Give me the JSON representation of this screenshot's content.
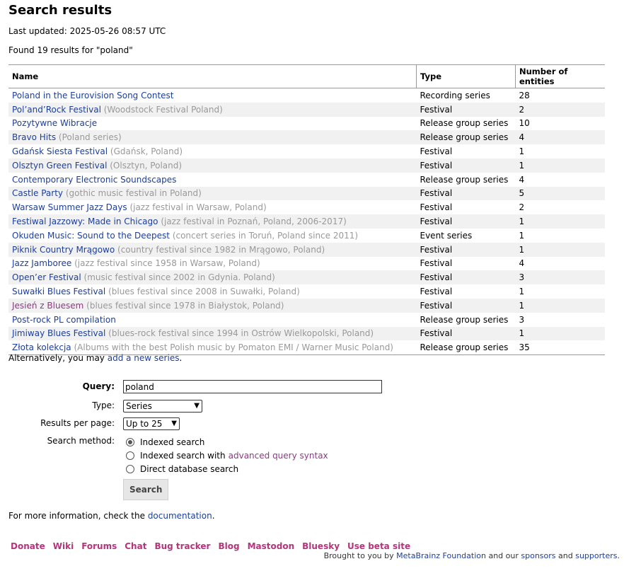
{
  "title": "Search results",
  "last_updated": "Last updated: 2025-05-26 08:57 UTC",
  "found": "Found 19 results for \"poland\"",
  "table": {
    "headers": [
      "Name",
      "Type",
      "Number of entities"
    ],
    "rows": [
      {
        "name": "Poland in the Eurovision Song Contest",
        "extra": "",
        "type": "Recording series",
        "count": "28"
      },
      {
        "name": "Pol’and’Rock Festival",
        "extra": "(Woodstock Festival Poland)",
        "type": "Festival",
        "count": "2"
      },
      {
        "name": "Pozytywne Wibracje",
        "extra": "",
        "type": "Release group series",
        "count": "10"
      },
      {
        "name": "Bravo Hits",
        "extra": "(Poland series)",
        "type": "Release group series",
        "count": "4"
      },
      {
        "name": "Gdańsk Siesta Festival",
        "extra": "(Gdańsk, Poland)",
        "type": "Festival",
        "count": "1"
      },
      {
        "name": "Olsztyn Green Festival",
        "extra": "(Olsztyn, Poland)",
        "type": "Festival",
        "count": "1"
      },
      {
        "name": "Contemporary Electronic Soundscapes",
        "extra": "",
        "type": "Release group series",
        "count": "4"
      },
      {
        "name": "Castle Party",
        "extra": "(gothic music festival in Poland)",
        "type": "Festival",
        "count": "5"
      },
      {
        "name": "Warsaw Summer Jazz Days",
        "extra": "(jazz festival in Warsaw, Poland)",
        "type": "Festival",
        "count": "2"
      },
      {
        "name": "Festiwal Jazzowy: Made in Chicago",
        "extra": "(jazz festival in Poznań, Poland, 2006-2017)",
        "type": "Festival",
        "count": "1"
      },
      {
        "name": "Okuden Music: Sound to the Deepest",
        "extra": "(concert series in Toruń, Poland since 2011)",
        "type": "Event series",
        "count": "1"
      },
      {
        "name": "Piknik Country Mrągowo",
        "extra": "(country festival since 1982 in Mrągowo, Poland)",
        "type": "Festival",
        "count": "1"
      },
      {
        "name": "Jazz Jamboree",
        "extra": "(jazz festival since 1958 in Warsaw, Poland)",
        "type": "Festival",
        "count": "4"
      },
      {
        "name": "Open’er Festival",
        "extra": "(music festival since 2002 in Gdynia. Poland)",
        "type": "Festival",
        "count": "3"
      },
      {
        "name": "Suwałki Blues Festival",
        "extra": "(blues festival since 2008 in Suwałki, Poland)",
        "type": "Festival",
        "count": "1"
      },
      {
        "name": "Jesień z Bluesem",
        "extra": "(blues festival since 1978 in Białystok, Poland)",
        "type": "Festival",
        "count": "1",
        "visited": true
      },
      {
        "name": "Post-rock PL compilation",
        "extra": "",
        "type": "Release group series",
        "count": "3"
      },
      {
        "name": "Jimiway Blues Festival",
        "extra": "(blues-rock festival since 1994 in Ostrów Wielkopolski, Poland)",
        "type": "Festival",
        "count": "1"
      },
      {
        "name": "Złota kolekcja",
        "extra": "(Albums with the best Polish music by Pomaton EMI / Warner Music Poland)",
        "type": "Release group series",
        "count": "35"
      }
    ]
  },
  "alt": {
    "prefix": "Alternatively, you may ",
    "link": "add a new series",
    "suffix": "."
  },
  "form": {
    "query_label": "Query:",
    "query_value": "poland",
    "type_label": "Type:",
    "type_value": "Series",
    "per_page_label": "Results per page:",
    "per_page_value": "Up to 25",
    "method_label": "Search method:",
    "method_indexed": "Indexed search",
    "method_advanced_prefix": "Indexed search with ",
    "method_advanced_link": "advanced query syntax",
    "method_direct": "Direct database search",
    "search_button": "Search"
  },
  "more_info": {
    "prefix": "For more information, check the ",
    "link": "documentation",
    "suffix": "."
  },
  "footer": {
    "links": [
      "Donate",
      "Wiki",
      "Forums",
      "Chat",
      "Bug tracker",
      "Blog",
      "Mastodon",
      "Bluesky",
      "Use beta site"
    ],
    "brought_prefix": "Brought to you by ",
    "brought_org": "MetaBrainz Foundation",
    "brought_mid": " and our ",
    "brought_sponsors": "sponsors",
    "brought_and": " and ",
    "brought_supporters": "supporters",
    "brought_end": "."
  }
}
